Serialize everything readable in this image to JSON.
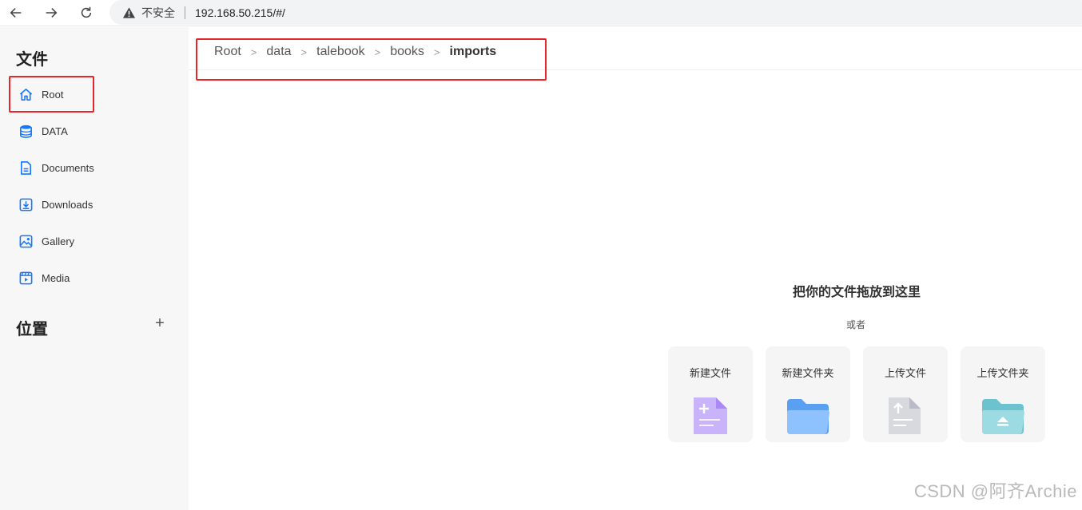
{
  "browser": {
    "security_label": "不安全",
    "url": "192.168.50.215/#/"
  },
  "sidebar": {
    "files_heading": "文件",
    "items": [
      {
        "label": "Root",
        "icon": "home-icon"
      },
      {
        "label": "DATA",
        "icon": "database-icon"
      },
      {
        "label": "Documents",
        "icon": "document-icon"
      },
      {
        "label": "Downloads",
        "icon": "download-icon"
      },
      {
        "label": "Gallery",
        "icon": "image-icon"
      },
      {
        "label": "Media",
        "icon": "video-icon"
      }
    ],
    "locations_heading": "位置",
    "add_label": "+"
  },
  "breadcrumb": {
    "items": [
      "Root",
      "data",
      "talebook",
      "books",
      "imports"
    ],
    "separator": ">"
  },
  "dropzone": {
    "title": "把你的文件拖放到这里",
    "or_text": "或者",
    "actions": [
      {
        "label": "新建文件",
        "icon": "new-file-icon"
      },
      {
        "label": "新建文件夹",
        "icon": "new-folder-icon"
      },
      {
        "label": "上传文件",
        "icon": "upload-file-icon"
      },
      {
        "label": "上传文件夹",
        "icon": "upload-folder-icon"
      }
    ]
  },
  "watermark": "CSDN @阿齐Archie",
  "colors": {
    "accent": "#1677ff",
    "highlight_box": "#e8262a",
    "sidebar_bg": "#f7f7f8"
  }
}
